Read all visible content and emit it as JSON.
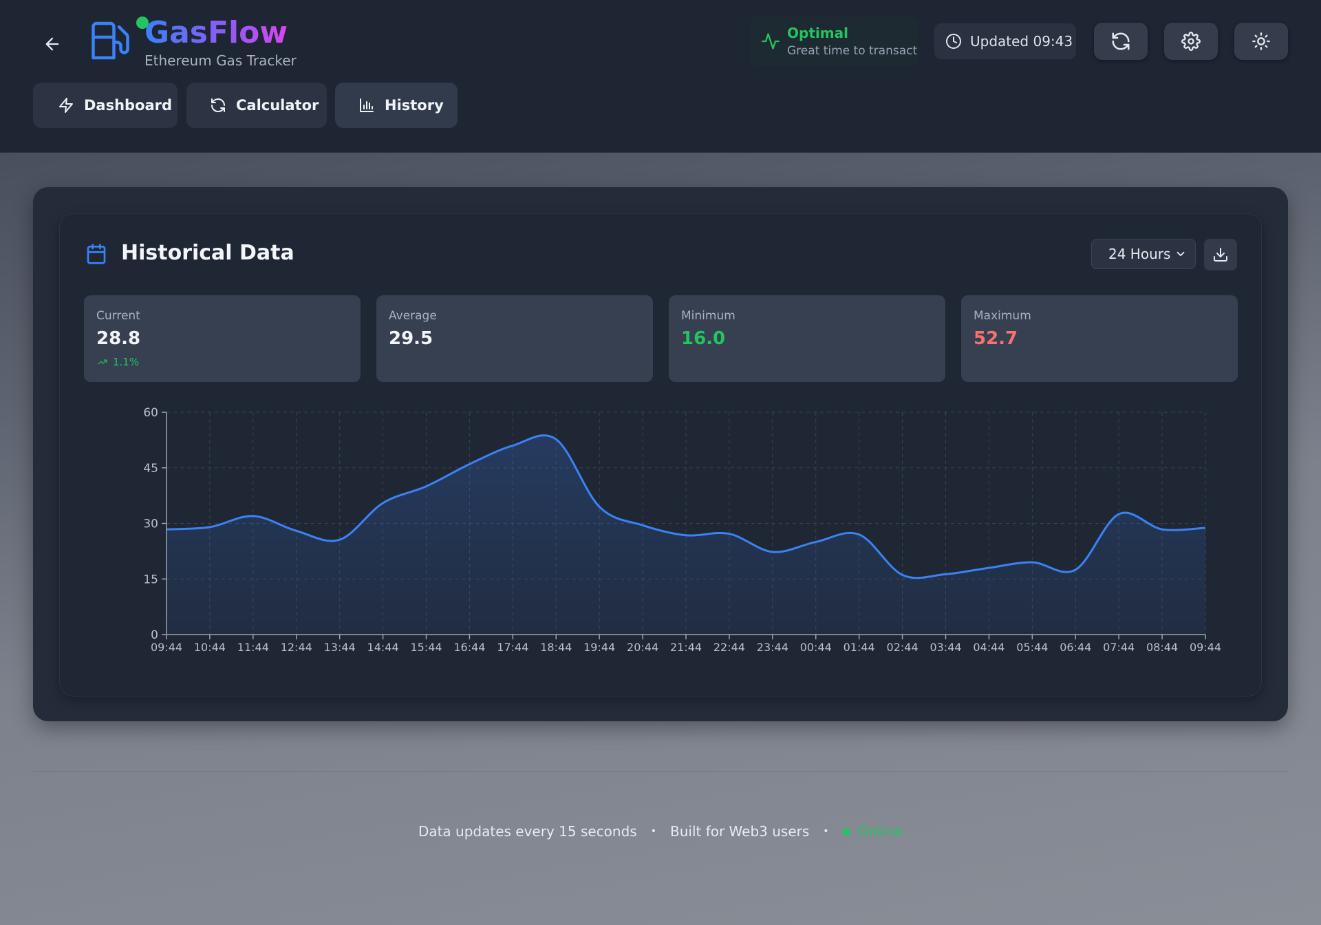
{
  "app": {
    "brand": "GasFlow",
    "tagline": "Ethereum Gas Tracker"
  },
  "status": {
    "title": "Optimal",
    "subtitle": "Great time to transact",
    "updated": "Updated 09:43"
  },
  "nav": {
    "dashboard": "Dashboard",
    "calculator": "Calculator",
    "history": "History"
  },
  "panel": {
    "title": "Historical Data",
    "range": "24 Hours"
  },
  "stats": {
    "current_label": "Current",
    "current_value": "28.8",
    "current_change": "1.1%",
    "average_label": "Average",
    "average_value": "29.5",
    "minimum_label": "Minimum",
    "minimum_value": "16.0",
    "maximum_label": "Maximum",
    "maximum_value": "52.7"
  },
  "colors": {
    "accent": "#3b82f6",
    "good": "#22c55e",
    "bad": "#f87171"
  },
  "chart_data": {
    "type": "area",
    "x": [
      "09:44",
      "10:44",
      "11:44",
      "12:44",
      "13:44",
      "14:44",
      "15:44",
      "16:44",
      "17:44",
      "18:44",
      "19:44",
      "20:44",
      "21:44",
      "22:44",
      "23:44",
      "00:44",
      "01:44",
      "02:44",
      "03:44",
      "04:44",
      "05:44",
      "06:44",
      "07:44",
      "08:44",
      "09:44"
    ],
    "values": [
      28.4,
      29,
      32,
      28,
      25.6,
      35.5,
      40,
      46,
      51,
      52.7,
      34.5,
      29.5,
      26.8,
      27.2,
      22.3,
      25,
      27,
      16.1,
      16.3,
      18,
      19.5,
      17.5,
      32.5,
      28.4,
      28.8
    ],
    "ylim": [
      0,
      60
    ],
    "yticks": [
      0,
      15,
      30,
      45,
      60
    ],
    "grid": true,
    "xlabel": "",
    "ylabel": ""
  },
  "footer": {
    "updates": "Data updates every 15 seconds",
    "built": "Built for Web3 users",
    "online": "Online"
  }
}
